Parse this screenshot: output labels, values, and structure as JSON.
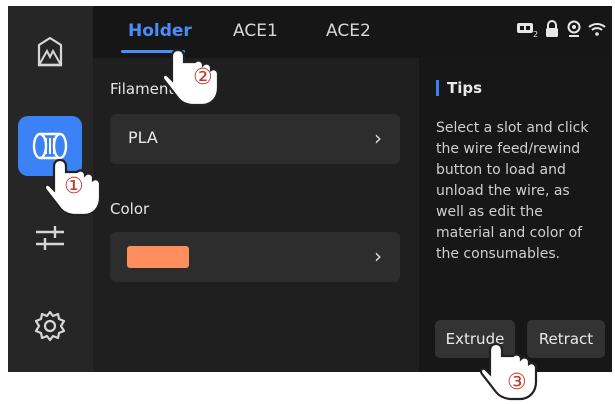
{
  "tabs": [
    {
      "label": "Holder",
      "active": true
    },
    {
      "label": "ACE1",
      "active": false
    },
    {
      "label": "ACE2",
      "active": false
    }
  ],
  "filament": {
    "label": "Filament",
    "value": "PLA"
  },
  "color": {
    "label": "Color",
    "swatch": "#ff8e5e"
  },
  "tips": {
    "title": "Tips",
    "text": "Select a slot and click the wire feed/rewind button to load and unload the wire, as well as edit the material and color of the consumables."
  },
  "actions": {
    "extrude": "Extrude",
    "retract": "Retract"
  },
  "steps": [
    "①",
    "②",
    "③"
  ],
  "accent": "#3b82f6"
}
